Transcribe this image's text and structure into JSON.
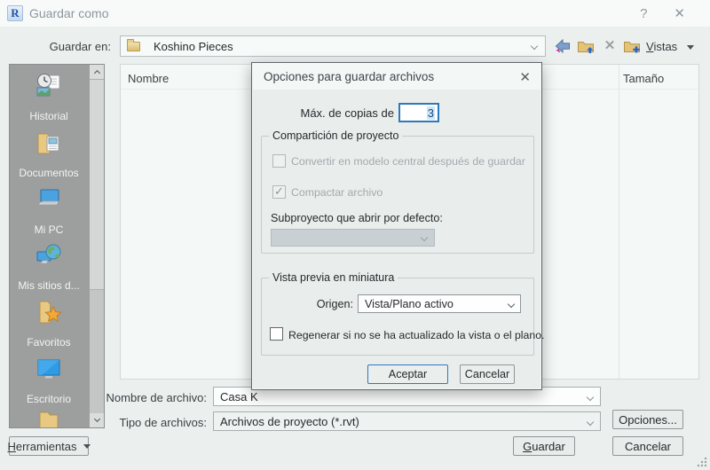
{
  "window": {
    "title": "Guardar como",
    "help_icon": "?",
    "close_icon": "✕"
  },
  "toolbar": {
    "save_in_label": "Guardar en:",
    "location_value": "Koshino Pieces",
    "views_label": "Vistas"
  },
  "sidebar": {
    "items": [
      {
        "label": "Historial",
        "icon": "history-icon"
      },
      {
        "label": "Documentos",
        "icon": "documents-icon"
      },
      {
        "label": "Mi PC",
        "icon": "my-pc-icon"
      },
      {
        "label": "Mis sitios d...",
        "icon": "network-places-icon"
      },
      {
        "label": "Favoritos",
        "icon": "favorites-icon"
      },
      {
        "label": "Escritorio",
        "icon": "desktop-icon"
      }
    ],
    "tools_button": "Herramientas"
  },
  "file_list": {
    "columns": [
      "Nombre",
      "Tamaño"
    ],
    "rows": []
  },
  "fields": {
    "file_name_label": "Nombre de archivo:",
    "file_name_value": "Casa K",
    "file_type_label": "Tipo de archivos:",
    "file_type_value": "Archivos de proyecto  (*.rvt)",
    "options_button": "Opciones...",
    "save_button": "Guardar",
    "cancel_button": "Cancelar"
  },
  "modal": {
    "title": "Opciones para guardar archivos",
    "close_icon": "✕",
    "max_backups_label": "Máx. de copias de",
    "max_backups_value": "3",
    "worksharing_group": {
      "title": "Compartición de proyecto",
      "make_central_checkbox": {
        "label": "Convertir en modelo central después de guardar",
        "checked": false,
        "enabled": false
      },
      "compact_checkbox": {
        "label": "Compactar archivo",
        "checked": true,
        "enabled": false
      },
      "workset_label": "Subproyecto que abrir por defecto:",
      "workset_value": ""
    },
    "preview_group": {
      "title": "Vista previa en miniatura",
      "source_label": "Origen:",
      "source_value": "Vista/Plano activo",
      "regenerate_checkbox": {
        "label": "Regenerar si no se ha actualizado la vista o el plano.",
        "checked": false,
        "enabled": true
      }
    },
    "accept_button": "Aceptar",
    "cancel_button": "Cancelar"
  },
  "colors": {
    "accent": "#2e78bc",
    "selection_bg": "#cfe6f8",
    "selection_text": "#17477e",
    "sidebar_bg": "#9d9e9e"
  }
}
